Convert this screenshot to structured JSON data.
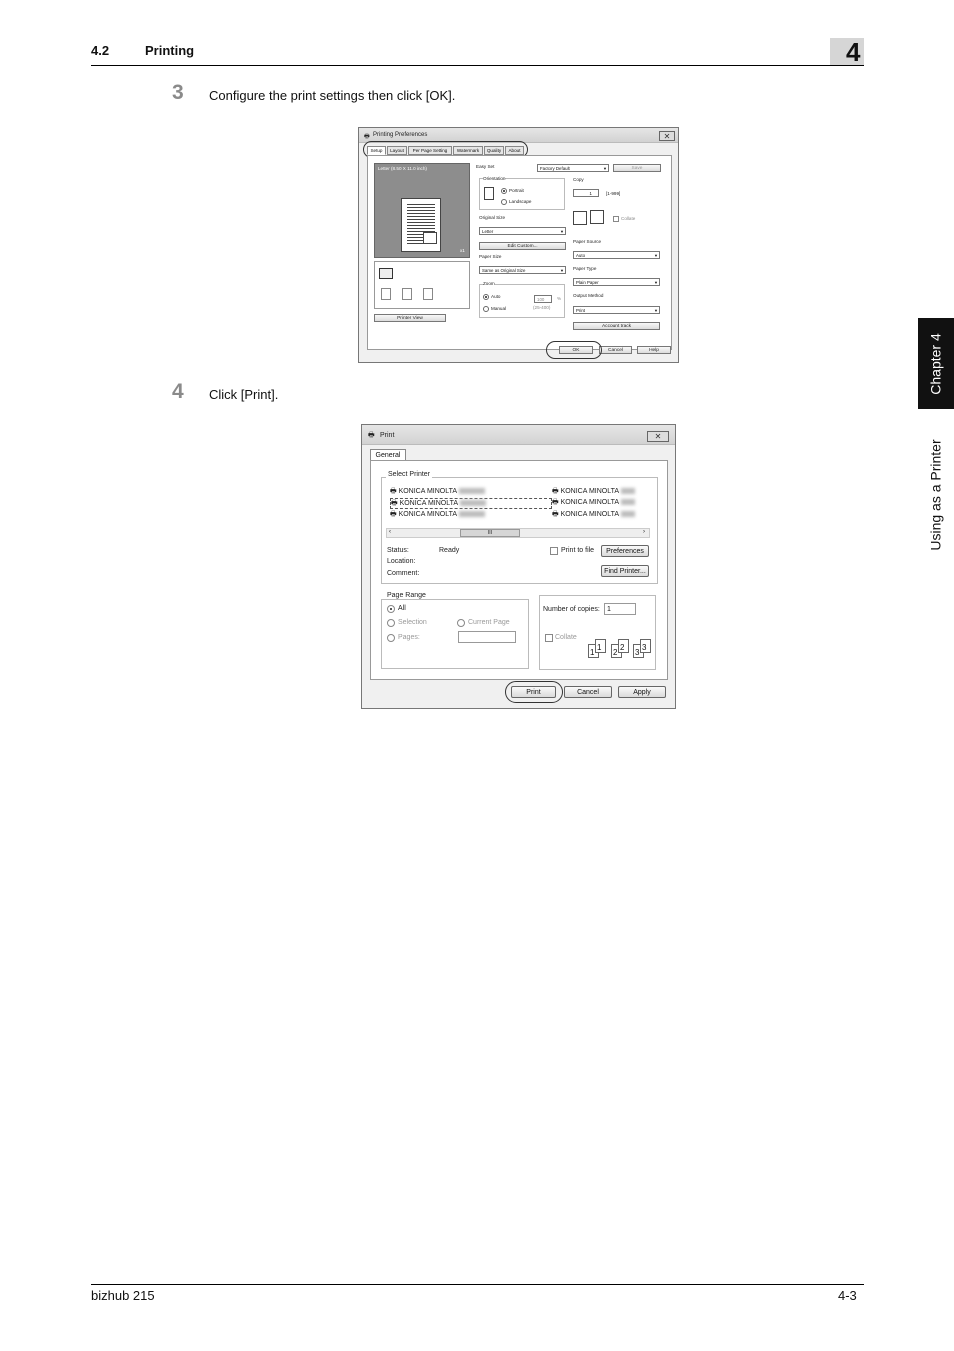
{
  "header": {
    "section_number": "4.2",
    "section_title": "Printing",
    "chapter_number": "4"
  },
  "side_tab": {
    "chapter_label": "Chapter 4",
    "topic_label": "Using as a Printer"
  },
  "steps": [
    {
      "number": "3",
      "text": "Configure the print settings then click [OK]."
    },
    {
      "number": "4",
      "text": "Click [Print]."
    }
  ],
  "printing_preferences": {
    "title": "Printing Preferences",
    "tabs": [
      "Setup",
      "Layout",
      "Per Page Setting",
      "Watermark",
      "Quality",
      "About"
    ],
    "preview_caption": "Letter (8.50 X 11.0 inch)",
    "preview_counter": "x1",
    "printer_view_button": "Printer View",
    "easy_set_label": "Easy Set",
    "easy_set_value": "Factory Default",
    "save_button": "Save",
    "orientation_label": "Orientation",
    "portrait_label": "Portrait",
    "landscape_label": "Landscape",
    "original_size_label": "Original Size",
    "original_size_value": "Letter",
    "edit_custom_button": "Edit Custom...",
    "paper_size_label": "Paper Size",
    "paper_size_value": "Same as Original Size",
    "zoom_label": "Zoom",
    "auto_label": "Auto",
    "manual_label": "Manual",
    "zoom_value": "100",
    "zoom_unit": "%",
    "zoom_range": "(25-400)",
    "copy_label": "Copy",
    "copy_value": "1",
    "copy_range": "[1-999]",
    "collate_label": "Collate",
    "paper_source_label": "Paper Source",
    "paper_source_value": "Auto",
    "paper_type_label": "Paper Type",
    "paper_type_value": "Plain Paper",
    "output_method_label": "Output Method",
    "output_method_value": "Print",
    "account_track_button": "Account track",
    "ok_button": "OK",
    "cancel_button": "Cancel",
    "help_button": "Help"
  },
  "print_dialog": {
    "title": "Print",
    "tab": "General",
    "select_printer_label": "Select Printer",
    "printers_left": [
      "KONICA MINOLTA",
      "KONICA MINOLTA",
      "KONICA MINOLTA"
    ],
    "printers_right": [
      "KONICA MINOLTA",
      "KONICA MINOLTA",
      "KONICA MINOLTA"
    ],
    "scroll_thumb": "III",
    "status_label": "Status:",
    "status_value": "Ready",
    "location_label": "Location:",
    "comment_label": "Comment:",
    "print_to_file_label": "Print to file",
    "preferences_button": "Preferences",
    "find_printer_button": "Find Printer...",
    "page_range_label": "Page Range",
    "all_label": "All",
    "selection_label": "Selection",
    "current_page_label": "Current Page",
    "pages_label": "Pages:",
    "copies_label": "Number of copies:",
    "copies_value": "1",
    "collate_label": "Collate",
    "collate_pages": [
      "1",
      "1",
      "2",
      "2",
      "3",
      "3"
    ],
    "print_button": "Print",
    "cancel_button": "Cancel",
    "apply_button": "Apply"
  },
  "footer": {
    "product": "bizhub 215",
    "page": "4-3"
  }
}
